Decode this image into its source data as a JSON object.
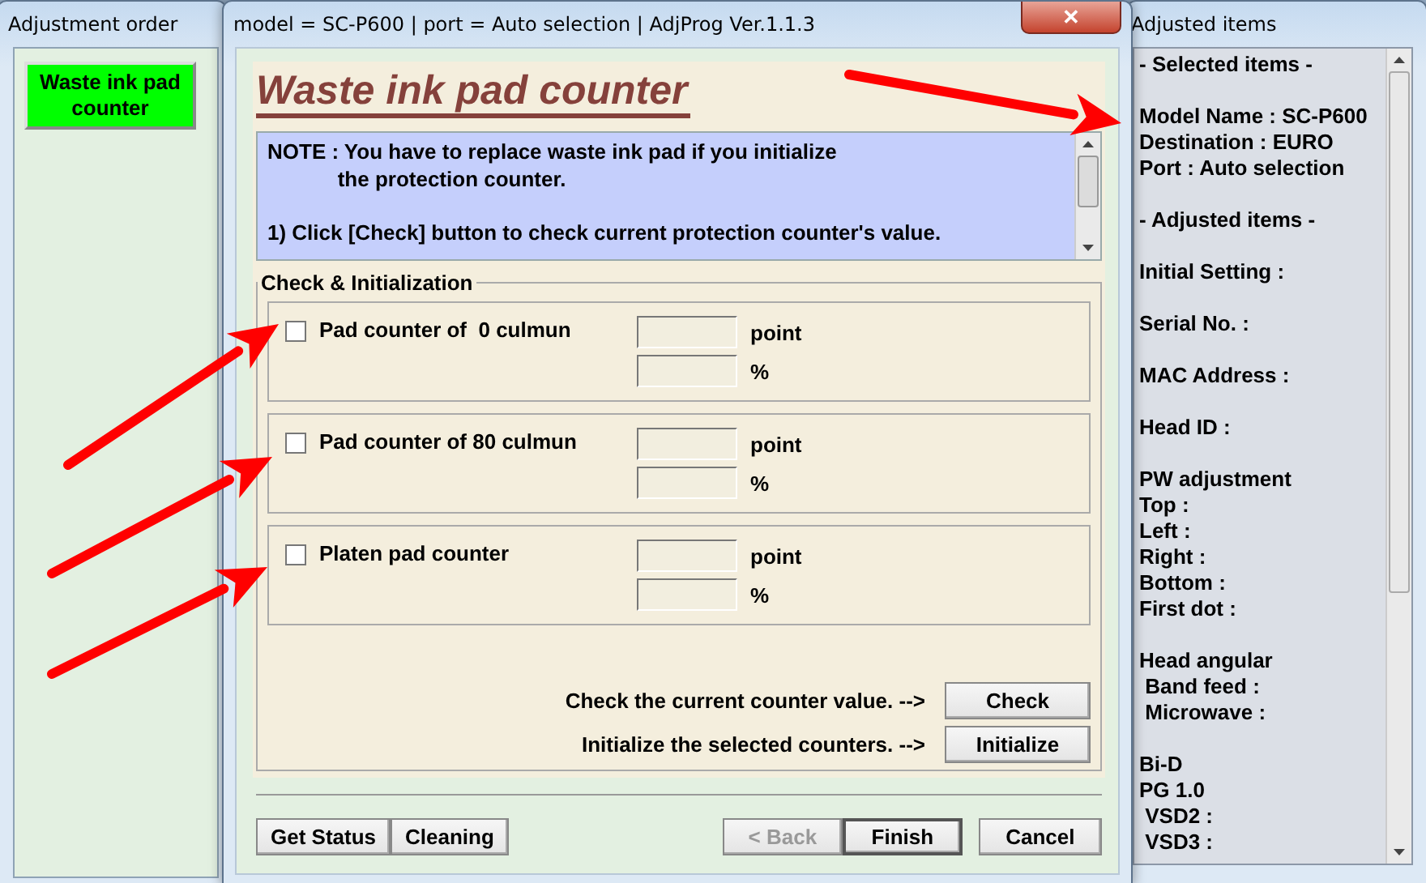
{
  "left_window": {
    "title": "Adjustment order",
    "items": [
      {
        "label": "Waste ink pad counter",
        "selected": true
      }
    ]
  },
  "main_window": {
    "title": "model = SC-P600 | port = Auto selection | AdjProg Ver.1.1.3",
    "close": "✕",
    "heading": "Waste ink pad counter",
    "note": [
      "NOTE : You have to replace waste ink pad if you initialize\n            the protection counter.",
      "1) Click [Check] button to check current protection counter's value."
    ],
    "group_title": "Check & Initialization",
    "counters": [
      {
        "label": "Pad counter of  0 culmun",
        "checked": false,
        "units": [
          "point",
          "%"
        ]
      },
      {
        "label": "Pad counter of 80 culmun",
        "checked": false,
        "units": [
          "point",
          "%"
        ]
      },
      {
        "label": "Platen pad counter",
        "checked": false,
        "units": [
          "point",
          "%"
        ]
      }
    ],
    "actions": [
      {
        "text": "Check the current counter value. -->",
        "button": "Check"
      },
      {
        "text": "Initialize the selected counters. -->",
        "button": "Initialize"
      }
    ],
    "footer_left": [
      "Get Status",
      "Cleaning"
    ],
    "footer_nav": [
      {
        "label": "< Back",
        "disabled": true,
        "default": false
      },
      {
        "label": "Finish",
        "disabled": false,
        "default": true
      }
    ],
    "footer_right": [
      "Cancel"
    ]
  },
  "right_window": {
    "title": "Adjusted items",
    "blocks": [
      [
        "- Selected items -"
      ],
      [
        "Model Name : SC-P600",
        "Destination : EURO",
        "Port : Auto selection"
      ],
      [
        "- Adjusted items -"
      ],
      [
        "Initial Setting :"
      ],
      [
        "Serial No. :"
      ],
      [
        "MAC Address :"
      ],
      [
        "Head ID :"
      ],
      [
        "PW adjustment",
        "Top :",
        "Left :",
        "Right :",
        "Bottom :",
        "First dot :"
      ],
      [
        "Head angular",
        " Band feed :",
        " Microwave :"
      ],
      [
        "Bi-D",
        "PG 1.0",
        " VSD2 :",
        " VSD3 :"
      ]
    ]
  }
}
